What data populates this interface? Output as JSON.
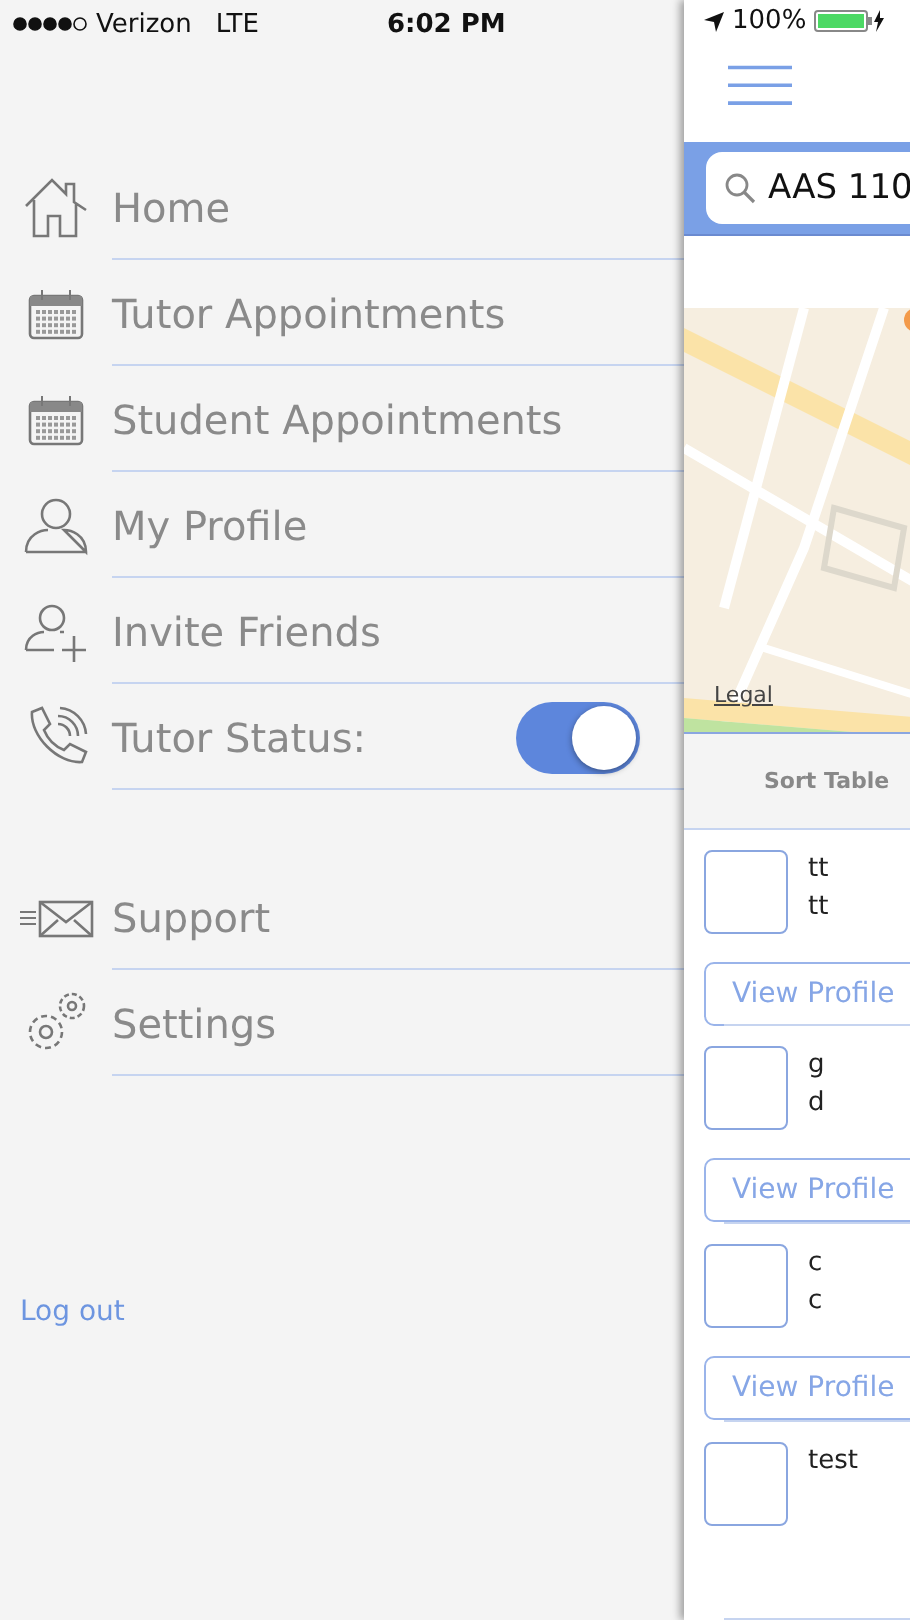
{
  "status_bar": {
    "carrier": "Verizon",
    "network": "LTE",
    "time": "6:02 PM",
    "battery": "100%"
  },
  "menu": {
    "items": [
      {
        "kind": "link",
        "label": "Home"
      },
      {
        "kind": "link",
        "label": "Tutor Appointments"
      },
      {
        "kind": "link",
        "label": "Student Appointments"
      },
      {
        "kind": "link",
        "label": "My Profile"
      },
      {
        "kind": "link",
        "label": "Invite Friends"
      },
      {
        "kind": "toggle",
        "label": "Tutor Status:",
        "on": true
      },
      {
        "kind": "spacer"
      },
      {
        "kind": "link",
        "label": "Support"
      },
      {
        "kind": "link",
        "label": "Settings"
      }
    ],
    "logout": "Log out"
  },
  "main": {
    "search": {
      "value": "AAS 110"
    },
    "map": {
      "kind": "picture",
      "legal": "Legal"
    },
    "sort_header": "Sort Table",
    "results": [
      {
        "line_1": "tt",
        "line_2": "tt",
        "button": "View Profile"
      },
      {
        "line_1": "g",
        "line_2": "d",
        "button": "View Profile"
      },
      {
        "line_1": "c",
        "line_2": "c",
        "button": "View Profile"
      },
      {
        "line_1": "test"
      }
    ]
  }
}
